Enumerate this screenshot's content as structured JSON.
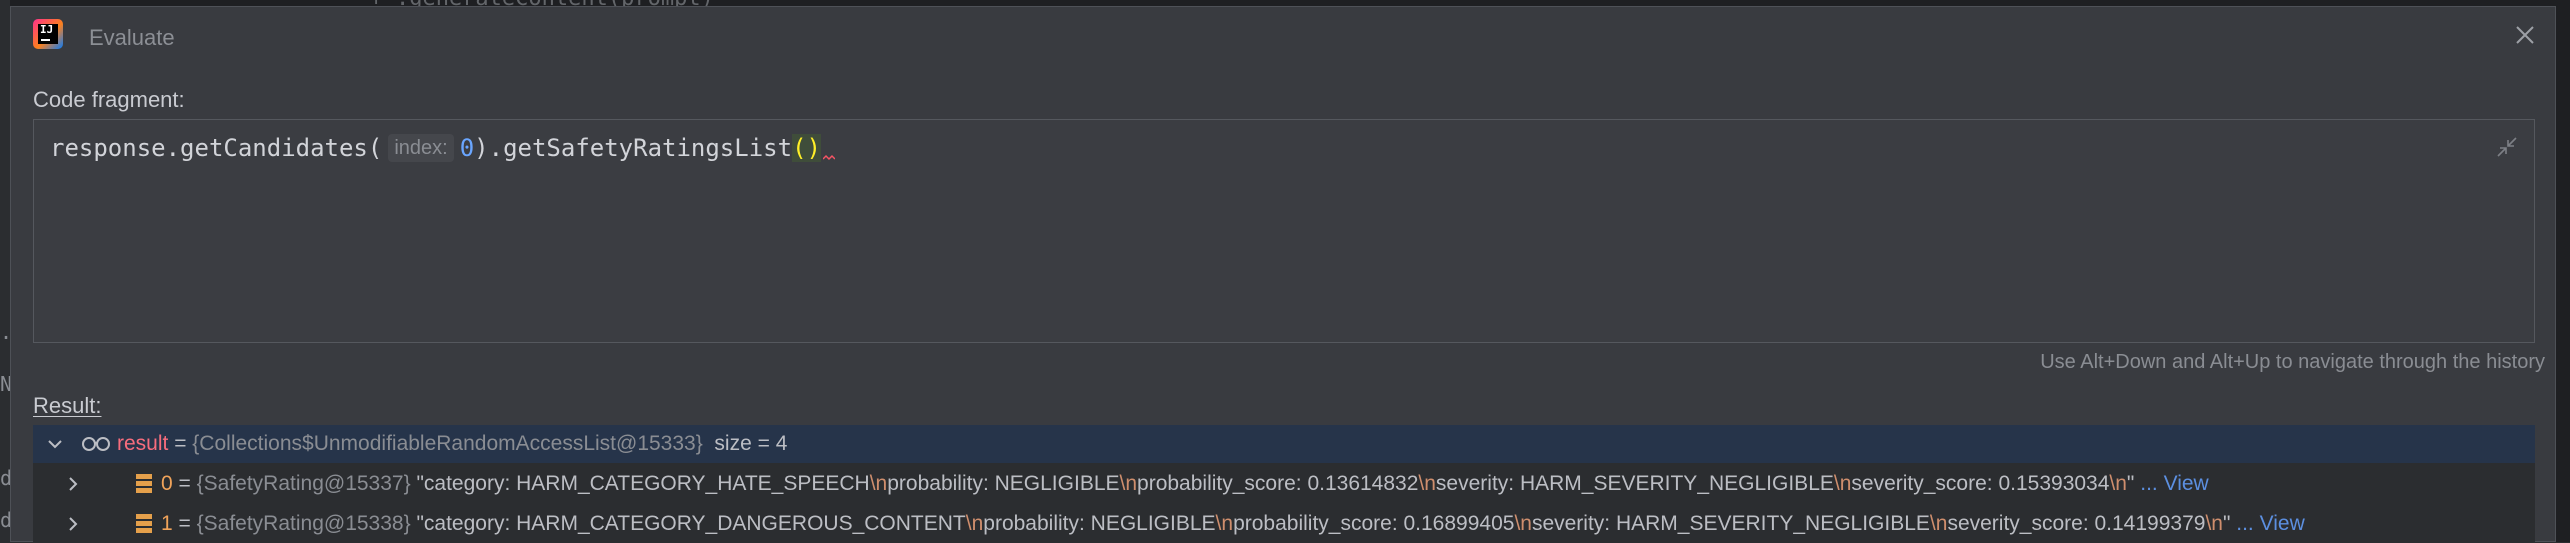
{
  "background": {
    "code_snippet": "      + .generateContent(prompt)",
    "left_glyphs": [
      ".",
      "N",
      "d",
      "d"
    ]
  },
  "dialog": {
    "title": "Evaluate",
    "close_icon": "close-icon"
  },
  "code_fragment": {
    "label": "Code fragment:",
    "before_hint": "response.getCandidates(",
    "hint_label": "index:",
    "hint_value": "0",
    "after_hint": ").getSafetyRatingsList",
    "parens": "()",
    "history_hint": "Use Alt+Down and Alt+Up to navigate through the history"
  },
  "result": {
    "label": "Result:",
    "root": {
      "name": "result",
      "eq": " = ",
      "type": "{Collections$UnmodifiableRandomAccessList@15333}",
      "size": "size = 4"
    },
    "items": [
      {
        "index": "0",
        "eq": " = ",
        "type": "{SafetyRating@15337}",
        "parts": [
          "\"category: HARM_CATEGORY_HATE_SPEECH",
          "\\n",
          "probability: NEGLIGIBLE",
          "\\n",
          "probability_score: 0.13614832",
          "\\n",
          "severity: HARM_SEVERITY_NEGLIGIBLE",
          "\\n",
          "severity_score: 0.15393034",
          "\\n",
          "\""
        ],
        "view": "... View"
      },
      {
        "index": "1",
        "eq": " = ",
        "type": "{SafetyRating@15338}",
        "parts": [
          "\"category: HARM_CATEGORY_DANGEROUS_CONTENT",
          "\\n",
          "probability: NEGLIGIBLE",
          "\\n",
          "probability_score: 0.16899405",
          "\\n",
          "severity: HARM_SEVERITY_NEGLIGIBLE",
          "\\n",
          "severity_score: 0.14199379",
          "\\n",
          "\""
        ],
        "view": "... View"
      }
    ]
  },
  "colors": {
    "dialog_bg": "#393b40",
    "selected_row": "#26344a",
    "escape": "#cf8e6d",
    "link": "#5c8fe0",
    "name_red": "#f76d7d",
    "name_orange": "#f0a35a"
  }
}
